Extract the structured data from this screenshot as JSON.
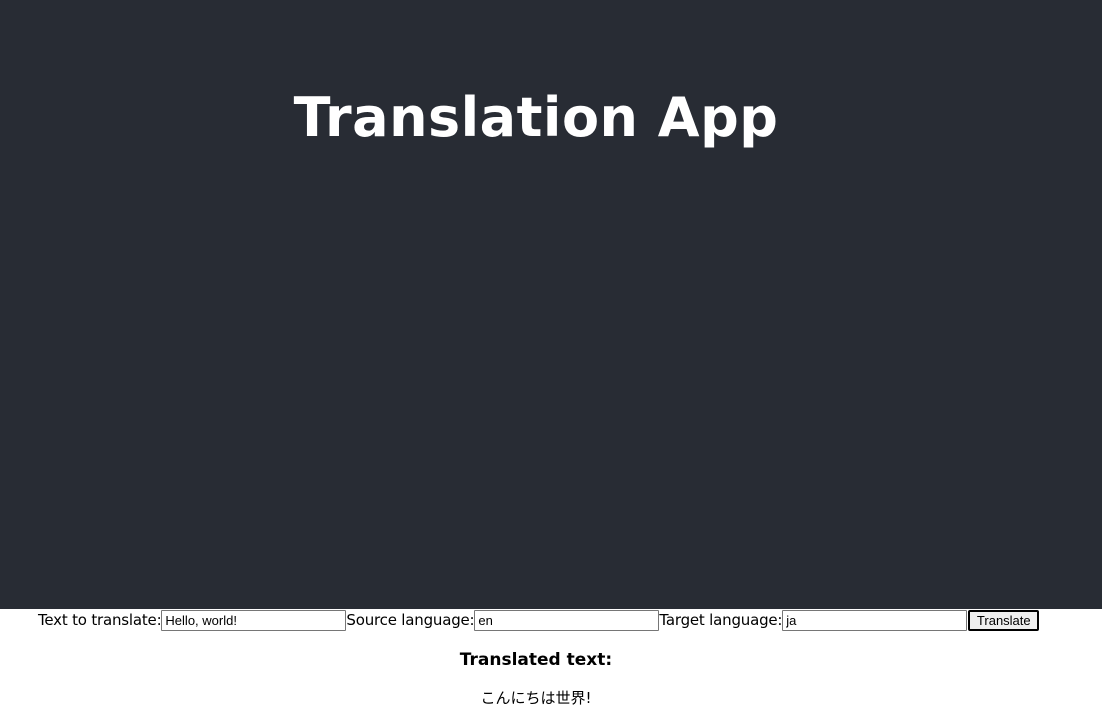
{
  "app": {
    "title": "Translation App"
  },
  "form": {
    "text_label": "Text to translate:",
    "text_value": "Hello, world!",
    "source_label": "Source language:",
    "source_value": "en",
    "target_label": "Target language:",
    "target_value": "ja",
    "translate_button_label": "Translate"
  },
  "result": {
    "heading": "Translated text:",
    "text": "こんにちは世界!"
  },
  "colors": {
    "header_background": "#282c34",
    "header_text": "#ffffff",
    "page_background": "#ffffff"
  }
}
